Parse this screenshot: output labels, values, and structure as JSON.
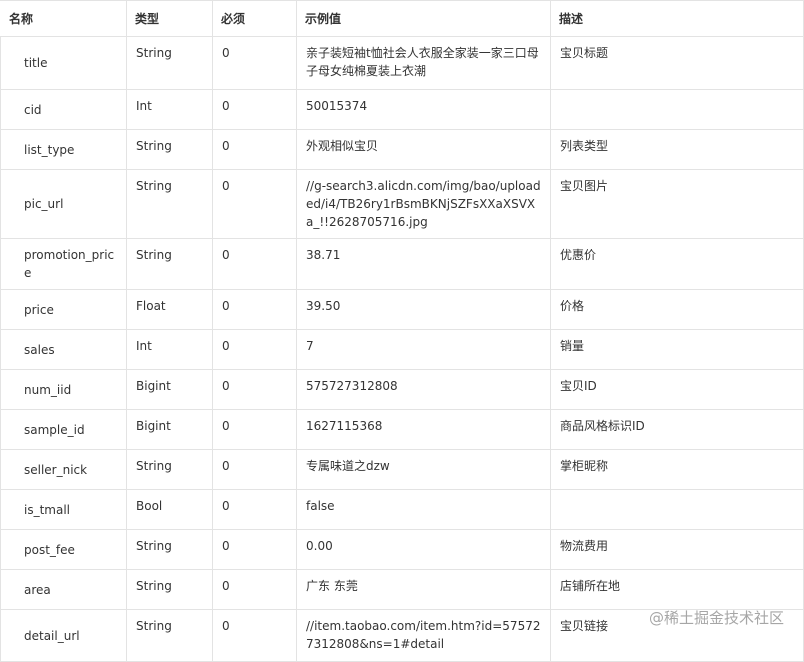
{
  "table": {
    "headers": [
      "名称",
      "类型",
      "必须",
      "示例值",
      "描述"
    ],
    "rows": [
      {
        "name": "title",
        "type": "String",
        "required": "0",
        "example": "亲子装短袖t恤社会人衣服全家装一家三口母子母女纯棉夏装上衣潮",
        "desc": "宝贝标题"
      },
      {
        "name": "cid",
        "type": "Int",
        "required": "0",
        "example": "50015374",
        "desc": ""
      },
      {
        "name": "list_type",
        "type": "String",
        "required": "0",
        "example": "外观相似宝贝",
        "desc": "列表类型"
      },
      {
        "name": "pic_url",
        "type": "String",
        "required": "0",
        "example": "//g-search3.alicdn.com/img/bao/uploaded/i4/TB26ry1rBsmBKNjSZFsXXaXSVXa_!!2628705716.jpg",
        "desc": "宝贝图片"
      },
      {
        "name": "promotion_price",
        "type": "String",
        "required": "0",
        "example": "38.71",
        "desc": "优惠价"
      },
      {
        "name": "price",
        "type": "Float",
        "required": "0",
        "example": "39.50",
        "desc": "价格"
      },
      {
        "name": "sales",
        "type": "Int",
        "required": "0",
        "example": "7",
        "desc": "销量"
      },
      {
        "name": "num_iid",
        "type": "Bigint",
        "required": "0",
        "example": "575727312808",
        "desc": "宝贝ID"
      },
      {
        "name": "sample_id",
        "type": "Bigint",
        "required": "0",
        "example": "1627115368",
        "desc": "商品风格标识ID"
      },
      {
        "name": "seller_nick",
        "type": "String",
        "required": "0",
        "example": "专属味道之dzw",
        "desc": "掌柜昵称"
      },
      {
        "name": "is_tmall",
        "type": "Bool",
        "required": "0",
        "example": "false",
        "desc": ""
      },
      {
        "name": "post_fee",
        "type": "String",
        "required": "0",
        "example": "0.00",
        "desc": "物流费用"
      },
      {
        "name": "area",
        "type": "String",
        "required": "0",
        "example": "广东 东莞",
        "desc": "店铺所在地"
      },
      {
        "name": "detail_url",
        "type": "String",
        "required": "0",
        "example": "//item.taobao.com/item.htm?id=575727312808&ns=1#detail",
        "desc": "宝贝链接"
      }
    ]
  },
  "watermark": "@稀土掘金技术社区"
}
